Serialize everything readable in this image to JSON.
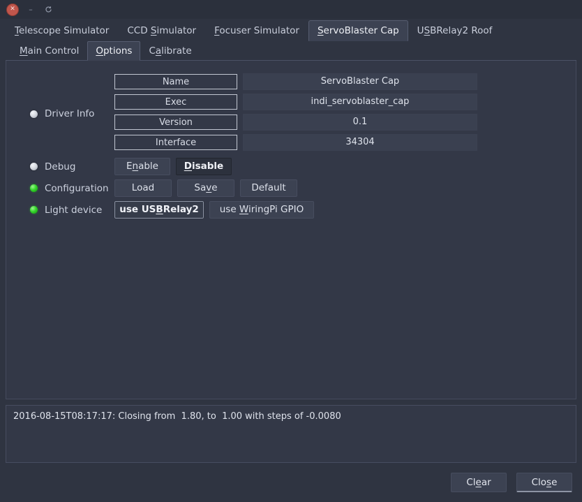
{
  "titlebar": {
    "close_label": "✕",
    "minimize_label": "–",
    "maximize_label": "↻"
  },
  "device_tabs": [
    {
      "label": "Telescope Simulator",
      "mnemonic_index": 0,
      "active": false
    },
    {
      "label": "CCD Simulator",
      "mnemonic_index": 4,
      "active": false
    },
    {
      "label": "Focuser Simulator",
      "mnemonic_index": 0,
      "active": false
    },
    {
      "label": "ServoBlaster Cap",
      "mnemonic_index": 0,
      "active": true
    },
    {
      "label": "USBRelay2 Roof",
      "mnemonic_index": 1,
      "active": false
    }
  ],
  "sub_tabs": [
    {
      "label": "Main Control",
      "mnemonic_index": 0,
      "active": false
    },
    {
      "label": "Options",
      "mnemonic_index": 0,
      "active": true
    },
    {
      "label": "Calibrate",
      "mnemonic_index": 1,
      "active": false
    }
  ],
  "properties": {
    "driver_info": {
      "label": "Driver Info",
      "led": "idle",
      "fields": [
        {
          "name": "Name",
          "value": "ServoBlaster Cap"
        },
        {
          "name": "Exec",
          "value": "indi_servoblaster_cap"
        },
        {
          "name": "Version",
          "value": "0.1"
        },
        {
          "name": "Interface",
          "value": "34304"
        }
      ]
    },
    "debug": {
      "label": "Debug",
      "led": "idle",
      "buttons": [
        {
          "label": "Enable",
          "mnemonic_index": 1,
          "state": "off"
        },
        {
          "label": "Disable",
          "mnemonic_index": 0,
          "state": "on"
        }
      ]
    },
    "configuration": {
      "label": "Configuration",
      "led": "ok",
      "buttons": [
        {
          "label": "Load",
          "mnemonic_index": -1,
          "state": "off"
        },
        {
          "label": "Save",
          "mnemonic_index": 2,
          "state": "off"
        },
        {
          "label": "Default",
          "mnemonic_index": -1,
          "state": "off"
        }
      ]
    },
    "light_device": {
      "label": "Light device",
      "led": "ok",
      "buttons": [
        {
          "label": "use USBRelay2",
          "mnemonic_index": 6,
          "state": "selected"
        },
        {
          "label": "use WiringPi GPIO",
          "mnemonic_index": 4,
          "state": "off"
        }
      ]
    }
  },
  "log": {
    "lines": [
      "2016-08-15T08:17:17: Closing from  1.80, to  1.00 with steps of -0.0080"
    ]
  },
  "footer": {
    "clear_label": "Clear",
    "clear_mnemonic_index": 2,
    "close_label": "Close",
    "close_mnemonic_index": 3
  },
  "colors": {
    "window_bg": "#2f3441",
    "panel_bg": "#333847",
    "tab_active_bg": "#3c4252",
    "text": "#d3d7e0",
    "led_ok": "#36d62c",
    "led_idle": "#d8dbe2",
    "close_button": "#c0564c"
  }
}
